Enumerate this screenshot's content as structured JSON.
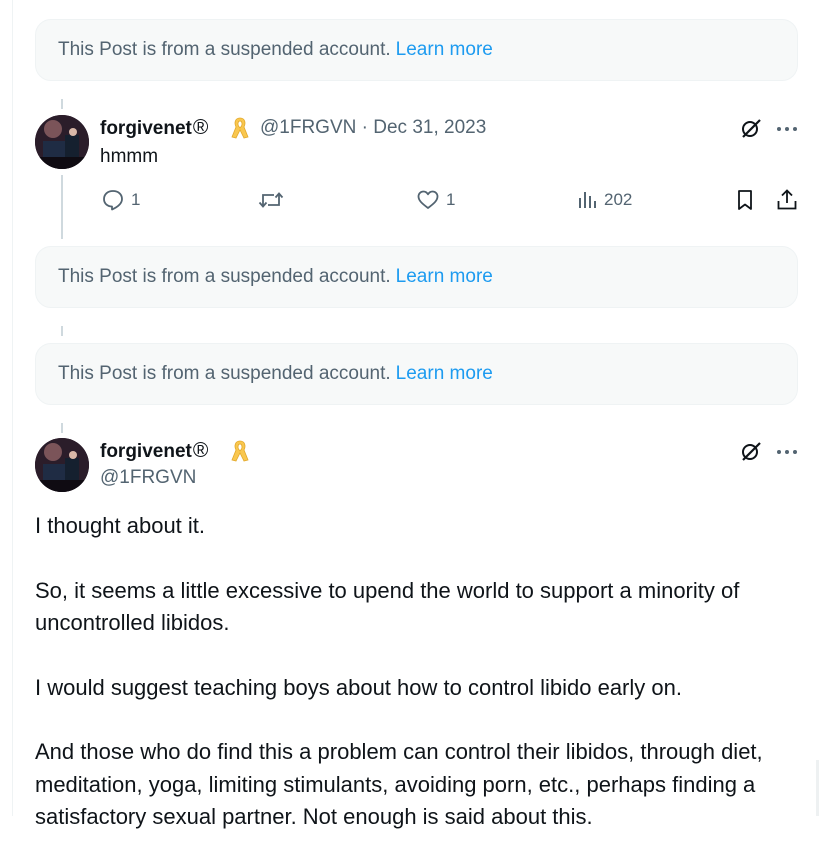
{
  "notices": [
    {
      "text": "This Post is from a suspended account.",
      "link": "Learn more"
    },
    {
      "text": "This Post is from a suspended account.",
      "link": "Learn more"
    },
    {
      "text": "This Post is from a suspended account.",
      "link": "Learn more"
    }
  ],
  "reply_post": {
    "display_name": "forgivenet",
    "reg_mark": "®",
    "handle": "@1FRGVN",
    "separator": "·",
    "date": "Dec 31, 2023",
    "text": "hmmm",
    "stats": {
      "replies": "1",
      "likes": "1",
      "views": "202"
    }
  },
  "main_post": {
    "display_name": "forgivenet",
    "reg_mark": "®",
    "handle": "@1FRGVN",
    "paragraphs": [
      "I thought about it.",
      "So, it seems a little excessive to upend the world to support a minority of uncontrolled libidos.",
      "I would suggest teaching boys about how to control libido early on.",
      "And those who do find this a problem can control their libidos, through diet, meditation, yoga, limiting stimulants, avoiding porn, etc., perhaps finding a satisfactory sexual partner. Not enough is said about this."
    ]
  },
  "colors": {
    "accent": "#1d9bf0",
    "muted": "#536471",
    "ribbon": "#f9c74f"
  }
}
